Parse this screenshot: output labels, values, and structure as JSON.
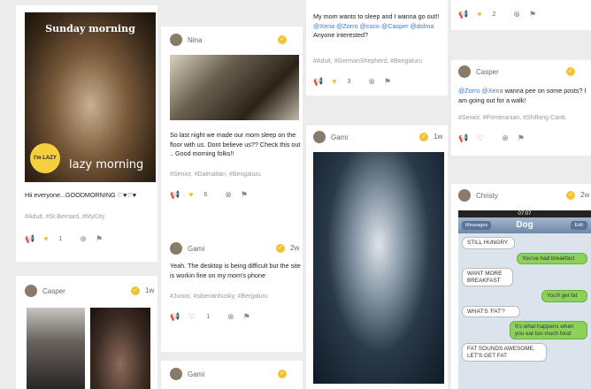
{
  "col1": {
    "photo": {
      "caption_top": "Sunday morning",
      "caption_bottom": "lazy morning",
      "badge": "I'm LAZY"
    },
    "text": "Hii everyone...GOODMORNING ♡♥♡♥",
    "tags": "#Adult, #St.Bernard, #MyCity",
    "likes": "1",
    "post2": {
      "user": "Casper",
      "time": "1w"
    }
  },
  "col2": {
    "post1": {
      "user": "Nina",
      "text": "So last night we made our mom sleep on the floor with us. Dont believe us?? Check this out .. Good morning folks!!",
      "tags": "#Senior, #Dalmatian, #Bengaluru",
      "likes": "6"
    },
    "post2": {
      "user": "Gami",
      "time": "2w",
      "text": "Yeah. The desktop is being difficult but the site is workin fine on my mom's phone",
      "tags": "#Junior, #siberianhusky, #Bergaluru",
      "likes": "1"
    },
    "post3": {
      "user": "Gami"
    }
  },
  "col3": {
    "post1": {
      "text_a": "My mom wants to sleep and I wanna go out!!",
      "mentions": [
        "@Xena",
        "@Zorro",
        "@coco",
        "@Casper",
        "@dolma"
      ],
      "text_b": "Anyone interested?",
      "tags": "#Adult, #GermanShepherd, #Bengaluru",
      "likes": "3"
    },
    "post2": {
      "user": "Gami",
      "time": "1w"
    }
  },
  "col4": {
    "top": {
      "likes": "2"
    },
    "post1": {
      "user": "Casper",
      "mentions": [
        "@Zorro",
        "@Xena"
      ],
      "text_a": "wanna pee on some posts? I",
      "text_b": "am going out for a walk!",
      "tags": "#Senior, #Pomeranian, #Shillong Cantt."
    },
    "post2": {
      "user": "Christy",
      "time": "2w",
      "phone": {
        "clock": "07:07",
        "back": "Messages",
        "title": "Dog",
        "edit": "Edit",
        "messages": [
          {
            "side": "left",
            "text": "STILL HUNGRY"
          },
          {
            "side": "right",
            "text": "You've had breakfast"
          },
          {
            "side": "left",
            "text": "WANT MORE BREAKFAST"
          },
          {
            "side": "right",
            "text": "You'll get fat"
          },
          {
            "side": "left",
            "text": "WHAT'S 'FAT'?"
          },
          {
            "side": "right",
            "text": "It's what happens when you eat too much food"
          },
          {
            "side": "left",
            "text": "FAT SOUNDS AWESOME. LET'S GET FAT"
          }
        ]
      }
    }
  },
  "colors": {
    "accent": "#f1c232",
    "link": "#3a7bd5",
    "bg": "#ececec"
  }
}
